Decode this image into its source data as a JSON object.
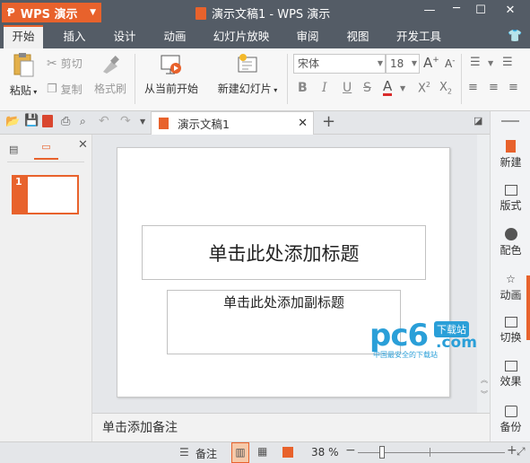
{
  "app": {
    "name": "WPS 演示",
    "window_title": "演示文稿1 - WPS 演示"
  },
  "menu_tabs": [
    {
      "label": "开始",
      "active": true
    },
    {
      "label": "插入"
    },
    {
      "label": "设计"
    },
    {
      "label": "动画"
    },
    {
      "label": "幻灯片放映"
    },
    {
      "label": "审阅"
    },
    {
      "label": "视图"
    },
    {
      "label": "开发工具"
    }
  ],
  "ribbon": {
    "paste": "粘贴",
    "cut": "剪切",
    "copy": "复制",
    "format_painter": "格式刷",
    "from_current": "从当前开始",
    "new_slide": "新建幻灯片",
    "font_name": "宋体",
    "font_size": "18",
    "bold": "B",
    "italic": "I",
    "underline": "U",
    "strike": "S",
    "font_color": "A"
  },
  "doc_tab": {
    "label": "演示文稿1"
  },
  "slide": {
    "number": "1",
    "title_placeholder": "单击此处添加标题",
    "subtitle_placeholder": "单击此处添加副标题"
  },
  "notes": {
    "placeholder": "单击添加备注"
  },
  "right_panel": [
    "新建",
    "版式",
    "配色",
    "动画",
    "切换",
    "效果",
    "备份"
  ],
  "status": {
    "notes_label": "备注",
    "zoom": "38 %"
  },
  "watermark": {
    "brand": "pc6",
    "tag": "下载站",
    "domain": ".com",
    "slogan": "中国最安全的下载站"
  },
  "colors": {
    "accent": "#e8622c",
    "titlebar": "#545c66"
  }
}
